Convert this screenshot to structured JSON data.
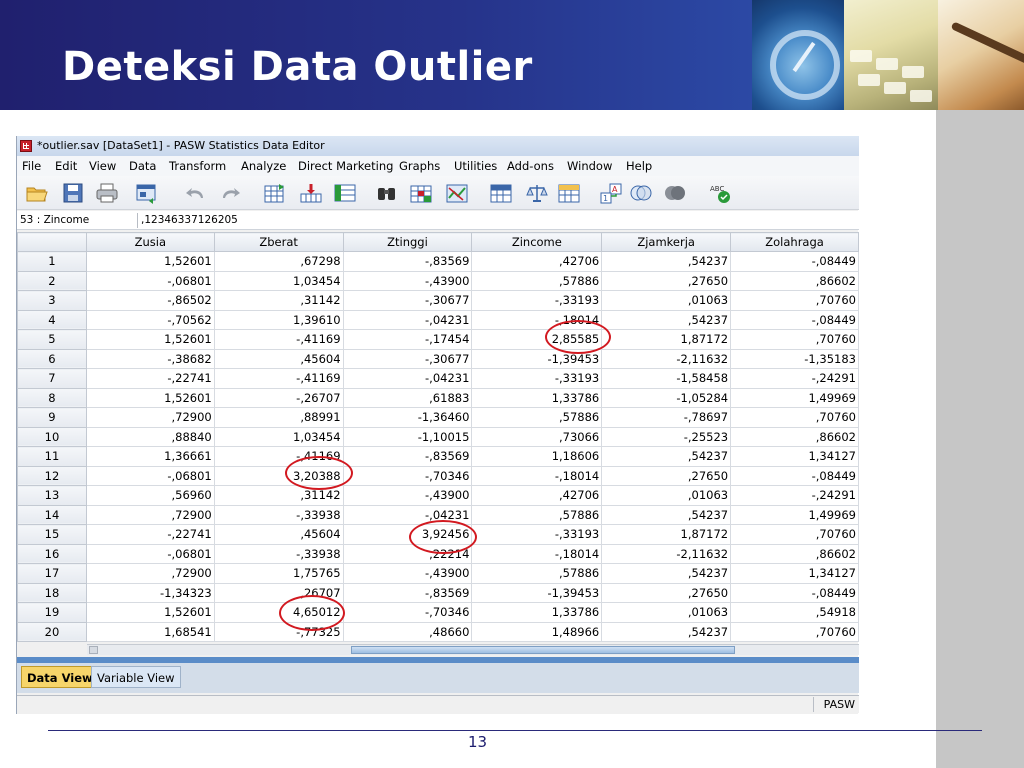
{
  "slide": {
    "title": "Deteksi Data Outlier",
    "page_number": "13"
  },
  "window": {
    "title": "*outlier.sav [DataSet1] - PASW Statistics Data Editor"
  },
  "menu": [
    "File",
    "Edit",
    "View",
    "Data",
    "Transform",
    "Analyze",
    "Direct Marketing",
    "Graphs",
    "Utilities",
    "Add-ons",
    "Window",
    "Help"
  ],
  "toolbar_icons": [
    "open-folder-icon",
    "save-icon",
    "print-icon",
    "dialog-recall-icon",
    "undo-icon",
    "redo-icon",
    "goto-case-icon",
    "goto-variable-icon",
    "variables-icon",
    "find-icon",
    "insert-cases-icon",
    "insert-variable-icon",
    "split-file-icon",
    "weight-cases-icon",
    "select-cases-icon",
    "value-labels-icon",
    "use-sets-icon",
    "show-all-variables-icon",
    "spell-check-icon"
  ],
  "cell_editor": {
    "reference": "53 : Zincome",
    "value": ",12346337126205"
  },
  "grid": {
    "columns": [
      "Zusia",
      "Zberat",
      "Ztinggi",
      "Zincome",
      "Zjamkerja",
      "Zolahraga"
    ],
    "rows": [
      {
        "n": "1",
        "v": [
          "1,52601",
          ",67298",
          "-,83569",
          ",42706",
          ",54237",
          "-,08449"
        ]
      },
      {
        "n": "2",
        "v": [
          "-,06801",
          "1,03454",
          "-,43900",
          ",57886",
          ",27650",
          ",86602"
        ]
      },
      {
        "n": "3",
        "v": [
          "-,86502",
          ",31142",
          "-,30677",
          "-,33193",
          ",01063",
          ",70760"
        ]
      },
      {
        "n": "4",
        "v": [
          "-,70562",
          "1,39610",
          "-,04231",
          "-,18014",
          ",54237",
          "-,08449"
        ]
      },
      {
        "n": "5",
        "v": [
          "1,52601",
          "-,41169",
          "-,17454",
          "2,85585",
          "1,87172",
          ",70760"
        ]
      },
      {
        "n": "6",
        "v": [
          "-,38682",
          ",45604",
          "-,30677",
          "-1,39453",
          "-2,11632",
          "-1,35183"
        ]
      },
      {
        "n": "7",
        "v": [
          "-,22741",
          "-,41169",
          "-,04231",
          "-,33193",
          "-1,58458",
          "-,24291"
        ]
      },
      {
        "n": "8",
        "v": [
          "1,52601",
          "-,26707",
          ",61883",
          "1,33786",
          "-1,05284",
          "1,49969"
        ]
      },
      {
        "n": "9",
        "v": [
          ",72900",
          ",88991",
          "-1,36460",
          ",57886",
          "-,78697",
          ",70760"
        ]
      },
      {
        "n": "10",
        "v": [
          ",88840",
          "1,03454",
          "-1,10015",
          ",73066",
          "-,25523",
          ",86602"
        ]
      },
      {
        "n": "11",
        "v": [
          "1,36661",
          "-,41169",
          "-,83569",
          "1,18606",
          ",54237",
          "1,34127"
        ]
      },
      {
        "n": "12",
        "v": [
          "-,06801",
          "3,20388",
          "-,70346",
          "-,18014",
          ",27650",
          "-,08449"
        ]
      },
      {
        "n": "13",
        "v": [
          ",56960",
          ",31142",
          "-,43900",
          ",42706",
          ",01063",
          "-,24291"
        ]
      },
      {
        "n": "14",
        "v": [
          ",72900",
          "-,33938",
          "-,04231",
          ",57886",
          ",54237",
          "1,49969"
        ]
      },
      {
        "n": "15",
        "v": [
          "-,22741",
          ",45604",
          "3,92456",
          "-,33193",
          "1,87172",
          ",70760"
        ]
      },
      {
        "n": "16",
        "v": [
          "-,06801",
          "-,33938",
          ",22214",
          "-,18014",
          "-2,11632",
          ",86602"
        ]
      },
      {
        "n": "17",
        "v": [
          ",72900",
          "1,75765",
          "-,43900",
          ",57886",
          ",54237",
          "1,34127"
        ]
      },
      {
        "n": "18",
        "v": [
          "-1,34323",
          ",26707",
          "-,83569",
          "-1,39453",
          ",27650",
          "-,08449"
        ]
      },
      {
        "n": "19",
        "v": [
          "1,52601",
          "4,65012",
          "-,70346",
          "1,33786",
          ",01063",
          ",54918"
        ]
      },
      {
        "n": "20",
        "v": [
          "1,68541",
          "-,77325",
          ",48660",
          "1,48966",
          ",54237",
          ",70760"
        ]
      }
    ],
    "highlighted_outliers": [
      {
        "row": "5",
        "column": "Zincome",
        "value": "2,85585"
      },
      {
        "row": "12",
        "column": "Zberat",
        "value": "3,20388"
      },
      {
        "row": "15",
        "column": "Ztinggi",
        "value": "3,92456"
      },
      {
        "row": "19",
        "column": "Zberat",
        "value": "4,65012"
      }
    ],
    "highlight_color": "#d21920"
  },
  "tabs": {
    "data_view": "Data View",
    "variable_view": "Variable View",
    "active": "Data View"
  },
  "status": {
    "text": "PASW"
  }
}
